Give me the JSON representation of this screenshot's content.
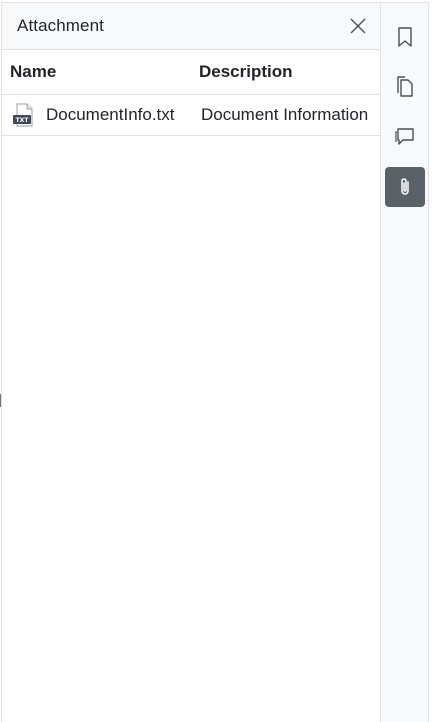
{
  "panel": {
    "title": "Attachment",
    "close_icon": "close-icon"
  },
  "table": {
    "columns": [
      "Name",
      "Description"
    ],
    "rows": [
      {
        "name": "DocumentInfo.txt",
        "description": "Document Information",
        "icon": "txt-file-icon",
        "icon_label": "TXT"
      }
    ]
  },
  "toolbar": {
    "items": [
      {
        "icon": "bookmark-icon",
        "active": false
      },
      {
        "icon": "page-thumbnails-icon",
        "active": false
      },
      {
        "icon": "comments-icon",
        "active": false
      },
      {
        "icon": "paperclip-icon",
        "active": true
      }
    ]
  },
  "colors": {
    "active_button": "#5a6268",
    "border": "#dee2e6",
    "header_bg": "#f8f9fa",
    "file_icon_badge": "#3d4a5c"
  }
}
